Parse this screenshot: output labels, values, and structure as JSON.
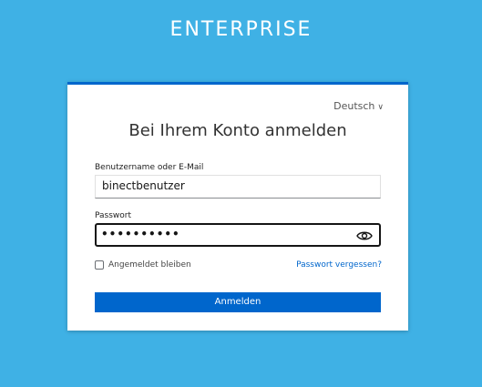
{
  "brand": "ENTERPRISE",
  "language": {
    "label": "Deutsch",
    "chevron": "∨"
  },
  "title": "Bei Ihrem Konto anmelden",
  "username": {
    "label": "Benutzername oder E-Mail",
    "value": "binectbenutzer"
  },
  "password": {
    "label": "Passwort",
    "value": "••••••••••",
    "toggle_icon": "eye-icon"
  },
  "remember": {
    "label": "Angemeldet bleiben",
    "checked": false
  },
  "forgot": {
    "label": "Passwort vergessen?"
  },
  "submit": {
    "label": "Anmelden"
  },
  "colors": {
    "background": "#3fb1e5",
    "primary": "#0066cc",
    "text": "#333333"
  }
}
